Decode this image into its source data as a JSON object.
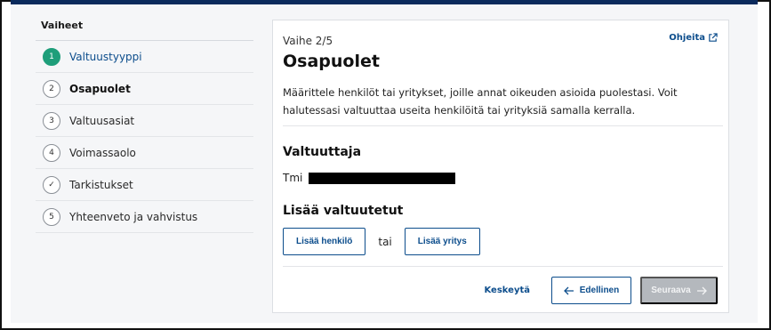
{
  "sidebar": {
    "title": "Vaiheet",
    "steps": [
      {
        "marker": "1",
        "label": "Valtuustyyppi",
        "state": "completed"
      },
      {
        "marker": "2",
        "label": "Osapuolet",
        "state": "current"
      },
      {
        "marker": "3",
        "label": "Valtuusasiat",
        "state": "upcoming"
      },
      {
        "marker": "4",
        "label": "Voimassaolo",
        "state": "upcoming"
      },
      {
        "marker": "✓",
        "label": "Tarkistukset",
        "state": "upcoming"
      },
      {
        "marker": "5",
        "label": "Yhteenveto ja vahvistus",
        "state": "upcoming"
      }
    ]
  },
  "main": {
    "step_counter": "Vaihe 2/5",
    "help_link": "Ohjeita",
    "title": "Osapuolet",
    "description": "Määrittele henkilöt tai yritykset, joille annat oikeuden asioida puolestasi. Voit halutessasi valtuuttaa useita henkilöitä tai yrityksiä samalla kerralla.",
    "principal": {
      "heading": "Valtuuttaja",
      "name_prefix": "Tmi"
    },
    "add_delegates": {
      "heading": "Lisää valtuutetut",
      "add_person": "Lisää henkilö",
      "or": "tai",
      "add_company": "Lisää yritys"
    },
    "footer": {
      "cancel": "Keskeytä",
      "previous": "Edellinen",
      "next": "Seuraava"
    }
  },
  "colors": {
    "accent_blue": "#0c4d8c",
    "completed_green": "#1e9e7a",
    "top_bar": "#0a2a5c",
    "disabled_button": "#b4b8bd"
  },
  "icons": {
    "help": "external-link-icon",
    "previous": "arrow-left-icon",
    "next": "arrow-right-icon",
    "checked_step": "checkmark-icon"
  }
}
